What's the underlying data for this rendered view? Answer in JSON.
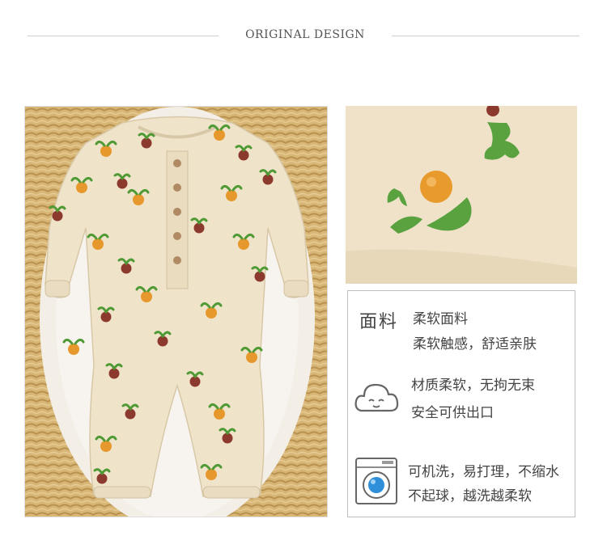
{
  "header": {
    "title": "ORIGINAL DESIGN"
  },
  "images": {
    "main": "baby-romper-fruit-print-photo",
    "detail": "fabric-print-closeup-photo"
  },
  "features": {
    "fabric": {
      "title": "面料",
      "line1": "柔软面料",
      "line2": "柔软触感，舒适亲肤"
    },
    "safety": {
      "icon": "cloud-face-icon",
      "line1": "材质柔软，无拘无束",
      "line2": "安全可供出口"
    },
    "washing": {
      "icon": "washing-machine-icon",
      "line1": "可机洗，易打理，不缩水",
      "line2": "不起球，越洗越柔软"
    }
  },
  "colors": {
    "fabric": "#efe3c9",
    "orange_fruit": "#e79a2e",
    "red_fruit": "#8c3a2e",
    "leaf": "#4f9a35",
    "basket": "#d9b97d"
  }
}
